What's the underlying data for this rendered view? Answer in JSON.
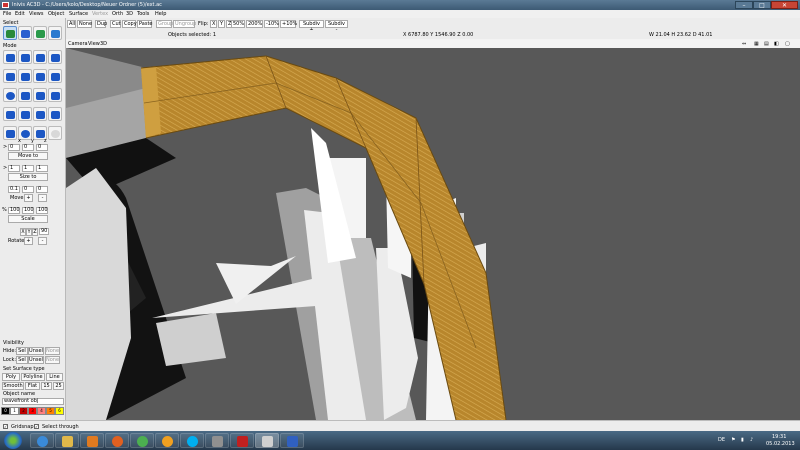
{
  "window": {
    "title": "Inivis AC3D - C:/Users/kolo/Desktop/Neuer Ordner (5)/ext.ac"
  },
  "menu": [
    "File",
    "Edit",
    "Views",
    "Object",
    "Surface",
    "Vertex",
    "Orth",
    "3D",
    "Tools",
    "Help"
  ],
  "toolbar": {
    "all": "All",
    "none": "None",
    "dup": "Dup",
    "cut": "Cut",
    "copy": "Copy",
    "paste": "Paste",
    "group": "Group",
    "ungroup": "Ungroup",
    "flip": "Flip:",
    "fx": "X",
    "fy": "Y",
    "fz": "Z",
    "z50": "50%",
    "z200": "200%",
    "m10": "-10%",
    "p10": "+10%",
    "subdiv_plus": "Subdiv +",
    "subdiv_minus": "Subdiv -"
  },
  "status": {
    "selected": "Objects selected: 1",
    "coords": "X 6787.80 Y 1546.90 Z 0.00",
    "dims": "W 21.04 H 23.62 D 41.01"
  },
  "panel": {
    "select": "Select",
    "mode": "Mode",
    "h_x": "x",
    "h_y": "y",
    "h_z": "z",
    "move_vals": [
      "0",
      "0",
      "0"
    ],
    "move_to": "Move to",
    "size_vals": [
      "1",
      "1",
      "1"
    ],
    "size_to": "Size to",
    "nudge_vals": [
      "0.1",
      "0",
      "0"
    ],
    "move": "Move",
    "plus": "+",
    "minus": "-",
    "pct": "%",
    "scale_vals": [
      "100",
      "100",
      "100"
    ],
    "scale": "Scale",
    "rx": "X",
    "ry": "Y",
    "rz": "Z",
    "rot_val": "90",
    "rotate": "Rotate",
    "visibility": "Visibility",
    "hide": "Hide:",
    "lock": "Lock:",
    "sel": "Sel",
    "unsel": "Unsel",
    "vnone": "None",
    "surface_type": "Set Surface type",
    "poly": "Poly",
    "polyline": "Polyline",
    "line": "Line",
    "smooth": "Smooth",
    "flat": "Flat",
    "a15": "15",
    "a25": "25",
    "object_name": "Object name",
    "name_value": "wavefront obj",
    "palette": [
      "#000000",
      "#ffffff",
      "#c00000",
      "#ff0000",
      "#ff8080",
      "#ff8000",
      "#ffff00"
    ],
    "palette_labels": [
      "0",
      "1",
      "2",
      "3",
      "4",
      "5",
      "6"
    ]
  },
  "view": {
    "camera": "Camera",
    "view": "View",
    "mode": "3D"
  },
  "bottom": {
    "gridsnap": "Gridsnap",
    "select_through": "Select through"
  },
  "taskbar": {
    "lang": "DE",
    "time": "19:31",
    "date": "05.02.2013"
  },
  "colors": {
    "tube": "#b8862c",
    "tube_light": "#d6a747",
    "panel": "#ececec",
    "viewport": "#585858"
  }
}
